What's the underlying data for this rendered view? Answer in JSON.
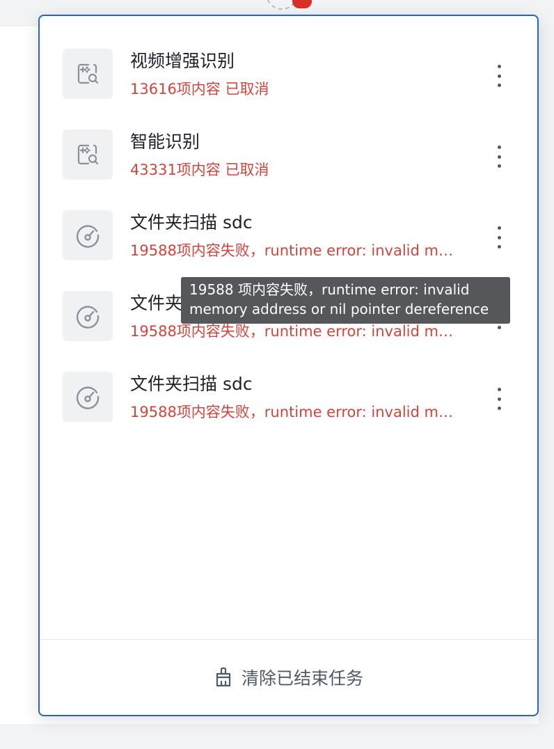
{
  "tasks": [
    {
      "title": "视频增强识别",
      "status": "13616项内容 已取消",
      "icon": "image-search-icon"
    },
    {
      "title": "智能识别",
      "status": "43331项内容 已取消",
      "icon": "image-search-icon"
    },
    {
      "title": "文件夹扫描 sdc",
      "status": "19588项内容失败，runtime error: invalid memory address or nil pointer dereference",
      "icon": "gauge-icon"
    },
    {
      "title": "文件夹扫描 sdc",
      "status": "19588项内容失败，runtime error: invalid memory address or nil pointer dereference",
      "icon": "gauge-icon"
    },
    {
      "title": "文件夹扫描 sdc",
      "status": "19588项内容失败，runtime error: invalid memory address or nil pointer dereference",
      "icon": "gauge-icon"
    }
  ],
  "tooltip": {
    "line1": "19588 项内容失败，runtime error: invalid",
    "line2": "memory address or nil pointer dereference"
  },
  "footer": {
    "label": "清除已结束任务",
    "icon": "broom-icon"
  },
  "colors": {
    "accent_border": "#2a63c8",
    "error_text": "#d4443a",
    "badge": "#d93026"
  }
}
